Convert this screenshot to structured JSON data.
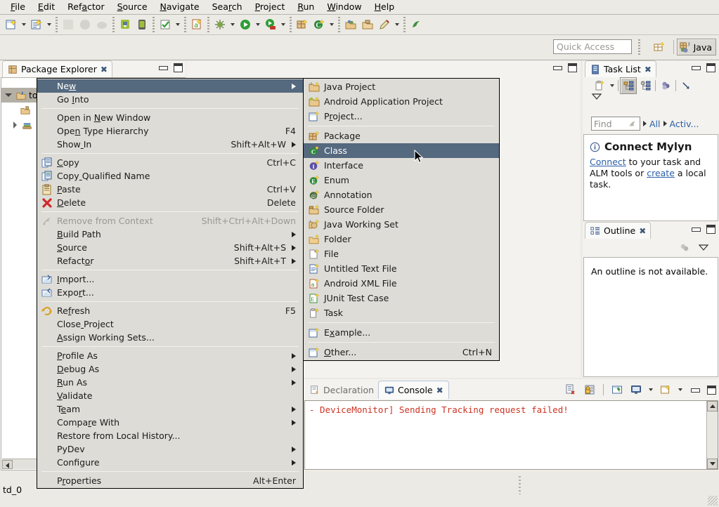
{
  "window": {
    "perspective": "Java",
    "quick_access_placeholder": "Quick Access"
  },
  "menubar": {
    "items": [
      {
        "label": "File",
        "mn": 0
      },
      {
        "label": "Edit",
        "mn": 0
      },
      {
        "label": "Refactor",
        "mn": 3
      },
      {
        "label": "Source",
        "mn": 0
      },
      {
        "label": "Navigate",
        "mn": 0
      },
      {
        "label": "Search",
        "mn": 3
      },
      {
        "label": "Project",
        "mn": 0
      },
      {
        "label": "Run",
        "mn": 0
      },
      {
        "label": "Window",
        "mn": 0
      },
      {
        "label": "Help",
        "mn": 0
      }
    ]
  },
  "toolbar": {
    "groups": [
      [
        "new-wizard-icon",
        "dropdown",
        "new-java-class-icon",
        "dropdown"
      ],
      [
        "save-icon",
        "save-all-icon",
        "print-icon"
      ],
      [
        "android-sdk-manager-icon",
        "android-avd-manager-icon"
      ],
      [
        "check-icon",
        "dropdown"
      ],
      [
        "new-android-xml-icon"
      ],
      [
        "debug-icon",
        "dropdown",
        "run-icon",
        "dropdown",
        "run-external-tools-icon",
        "dropdown"
      ],
      [
        "new-package-icon",
        "new-class-icon",
        "dropdown"
      ],
      [
        "open-type-icon",
        "open-task-icon",
        "annotate-icon",
        "dropdown"
      ],
      [
        "pydev-icon"
      ]
    ]
  },
  "package_explorer": {
    "tab_label": "Package Explorer",
    "tree": [
      {
        "label": "to",
        "icon": "java-project-icon",
        "state": "expanded",
        "selected": true,
        "indent": 0
      },
      {
        "label": "",
        "icon": "src-folder-icon",
        "state": "leaf",
        "selected": false,
        "indent": 1
      },
      {
        "label": "",
        "icon": "library-icon",
        "state": "collapsed",
        "selected": false,
        "indent": 1
      }
    ]
  },
  "task_list": {
    "tab_label": "Task List",
    "find_placeholder": "Find",
    "filters": [
      "All",
      "Activ..."
    ],
    "notice_title": "Connect Mylyn",
    "notice_body_parts": [
      "Connect",
      " to your task and",
      "ALM tools or ",
      "create",
      " a",
      "local task."
    ],
    "toolbar_icons": [
      "new-task-icon",
      "dropdown",
      "categorized-view-icon",
      "scheduled-view-icon",
      "focus-icon",
      "collapse-icon",
      "view-menu-icon"
    ]
  },
  "outline": {
    "tab_label": "Outline",
    "message": "An outline is not available.",
    "toolbar_icons": [
      "sort-icon",
      "view-menu-icon"
    ]
  },
  "console": {
    "tabs": [
      {
        "label": "Declaration",
        "active": false,
        "icon": "declaration-icon"
      },
      {
        "label": "Console",
        "active": true,
        "icon": "console-icon"
      }
    ],
    "toolbar_icons": [
      "clear-console-icon",
      "lock-scroll-icon",
      "pin-console-icon",
      "display-console-icon",
      "dropdown",
      "open-console-icon",
      "dropdown"
    ],
    "output_lines": [
      "- DeviceMonitor] Sending Tracking request failed!"
    ],
    "output_color": "#cc3322"
  },
  "status_bar": {
    "text": "td_0"
  },
  "context_menu": {
    "items": [
      {
        "type": "item",
        "label": "New",
        "mn": 2,
        "accel": "",
        "submenu": true,
        "highlighted": true,
        "icon": null
      },
      {
        "type": "item",
        "label": "Go Into",
        "mn": 3,
        "accel": "",
        "submenu": false,
        "icon": null
      },
      {
        "type": "sep"
      },
      {
        "type": "item",
        "label": "Open in New Window",
        "mn": 8,
        "accel": "",
        "submenu": false,
        "icon": null
      },
      {
        "type": "item",
        "label": "Open Type Hierarchy",
        "mn": 3,
        "accel": "F4",
        "submenu": false,
        "icon": null
      },
      {
        "type": "item",
        "label": "Show In",
        "mn": 4,
        "accel": "Shift+Alt+W",
        "submenu": true,
        "icon": null
      },
      {
        "type": "sep"
      },
      {
        "type": "item",
        "label": "Copy",
        "mn": 0,
        "accel": "Ctrl+C",
        "submenu": false,
        "icon": "copy-icon"
      },
      {
        "type": "item",
        "label": "Copy Qualified Name",
        "mn": 4,
        "accel": "",
        "submenu": false,
        "icon": "copy-qualified-icon"
      },
      {
        "type": "item",
        "label": "Paste",
        "mn": 0,
        "accel": "Ctrl+V",
        "submenu": false,
        "icon": "paste-icon"
      },
      {
        "type": "item",
        "label": "Delete",
        "mn": 0,
        "accel": "Delete",
        "submenu": false,
        "icon": "delete-icon"
      },
      {
        "type": "sep"
      },
      {
        "type": "item",
        "label": "Remove from Context",
        "mn": -1,
        "accel": "Shift+Ctrl+Alt+Down",
        "submenu": false,
        "disabled": true,
        "icon": "remove-context-icon"
      },
      {
        "type": "item",
        "label": "Build Path",
        "mn": 0,
        "accel": "",
        "submenu": true,
        "icon": null
      },
      {
        "type": "item",
        "label": "Source",
        "mn": 0,
        "accel": "Shift+Alt+S",
        "submenu": true,
        "icon": null
      },
      {
        "type": "item",
        "label": "Refactor",
        "mn": 6,
        "accel": "Shift+Alt+T",
        "submenu": true,
        "icon": null
      },
      {
        "type": "sep"
      },
      {
        "type": "item",
        "label": "Import...",
        "mn": 0,
        "accel": "",
        "submenu": false,
        "icon": "import-icon"
      },
      {
        "type": "item",
        "label": "Export...",
        "mn": 4,
        "accel": "",
        "submenu": false,
        "icon": "export-icon"
      },
      {
        "type": "sep"
      },
      {
        "type": "item",
        "label": "Refresh",
        "mn": 2,
        "accel": "F5",
        "submenu": false,
        "icon": "refresh-icon"
      },
      {
        "type": "item",
        "label": "Close Project",
        "mn": 5,
        "accel": "",
        "submenu": false,
        "icon": null
      },
      {
        "type": "item",
        "label": "Assign Working Sets...",
        "mn": 0,
        "accel": "",
        "submenu": false,
        "icon": null
      },
      {
        "type": "sep"
      },
      {
        "type": "item",
        "label": "Profile As",
        "mn": 0,
        "accel": "",
        "submenu": true,
        "icon": null
      },
      {
        "type": "item",
        "label": "Debug As",
        "mn": 0,
        "accel": "",
        "submenu": true,
        "icon": null
      },
      {
        "type": "item",
        "label": "Run As",
        "mn": 0,
        "accel": "",
        "submenu": true,
        "icon": null
      },
      {
        "type": "item",
        "label": "Validate",
        "mn": 0,
        "accel": "",
        "submenu": false,
        "icon": null
      },
      {
        "type": "item",
        "label": "Team",
        "mn": 1,
        "accel": "",
        "submenu": true,
        "icon": null
      },
      {
        "type": "item",
        "label": "Compare With",
        "mn": 5,
        "accel": "",
        "submenu": true,
        "icon": null
      },
      {
        "type": "item",
        "label": "Restore from Local History...",
        "mn": -1,
        "accel": "",
        "submenu": false,
        "icon": null
      },
      {
        "type": "item",
        "label": "PyDev",
        "mn": -1,
        "accel": "",
        "submenu": true,
        "icon": null
      },
      {
        "type": "item",
        "label": "Configure",
        "mn": -1,
        "accel": "",
        "submenu": true,
        "icon": null
      },
      {
        "type": "sep"
      },
      {
        "type": "item",
        "label": "Properties",
        "mn": 1,
        "accel": "Alt+Enter",
        "submenu": false,
        "icon": null
      }
    ]
  },
  "sub_menu": {
    "items": [
      {
        "type": "item",
        "label": "Java Project",
        "mn": -1,
        "accel": "",
        "icon": "java-project-icon"
      },
      {
        "type": "item",
        "label": "Android Application Project",
        "mn": -1,
        "accel": "",
        "icon": "android-project-icon"
      },
      {
        "type": "item",
        "label": "Project...",
        "mn": 1,
        "accel": "",
        "icon": "project-icon"
      },
      {
        "type": "sep"
      },
      {
        "type": "item",
        "label": "Package",
        "mn": -1,
        "accel": "",
        "icon": "package-icon"
      },
      {
        "type": "item",
        "label": "Class",
        "mn": -1,
        "accel": "",
        "icon": "class-icon",
        "highlighted": true
      },
      {
        "type": "item",
        "label": "Interface",
        "mn": -1,
        "accel": "",
        "icon": "interface-icon"
      },
      {
        "type": "item",
        "label": "Enum",
        "mn": -1,
        "accel": "",
        "icon": "enum-icon"
      },
      {
        "type": "item",
        "label": "Annotation",
        "mn": -1,
        "accel": "",
        "icon": "annotation-icon"
      },
      {
        "type": "item",
        "label": "Source Folder",
        "mn": -1,
        "accel": "",
        "icon": "source-folder-icon"
      },
      {
        "type": "item",
        "label": "Java Working Set",
        "mn": -1,
        "accel": "",
        "icon": "java-working-set-icon"
      },
      {
        "type": "item",
        "label": "Folder",
        "mn": -1,
        "accel": "",
        "icon": "folder-icon"
      },
      {
        "type": "item",
        "label": "File",
        "mn": -1,
        "accel": "",
        "icon": "file-icon"
      },
      {
        "type": "item",
        "label": "Untitled Text File",
        "mn": -1,
        "accel": "",
        "icon": "text-file-icon"
      },
      {
        "type": "item",
        "label": "Android XML File",
        "mn": -1,
        "accel": "",
        "icon": "android-xml-icon"
      },
      {
        "type": "item",
        "label": "JUnit Test Case",
        "mn": -1,
        "accel": "",
        "icon": "junit-icon"
      },
      {
        "type": "item",
        "label": "Task",
        "mn": -1,
        "accel": "",
        "icon": "task-icon"
      },
      {
        "type": "sep"
      },
      {
        "type": "item",
        "label": "Example...",
        "mn": 1,
        "accel": "",
        "icon": "example-icon"
      },
      {
        "type": "sep"
      },
      {
        "type": "item",
        "label": "Other...",
        "mn": 0,
        "accel": "Ctrl+N",
        "icon": "other-icon"
      }
    ]
  },
  "colors": {
    "menu_highlight": "#55697f",
    "menu_bg": "#dedcd6",
    "chrome_bg": "#eceae4",
    "link": "#2b5fa8",
    "console_error": "#cc3322",
    "tree_selection": "#b5b0a5"
  }
}
